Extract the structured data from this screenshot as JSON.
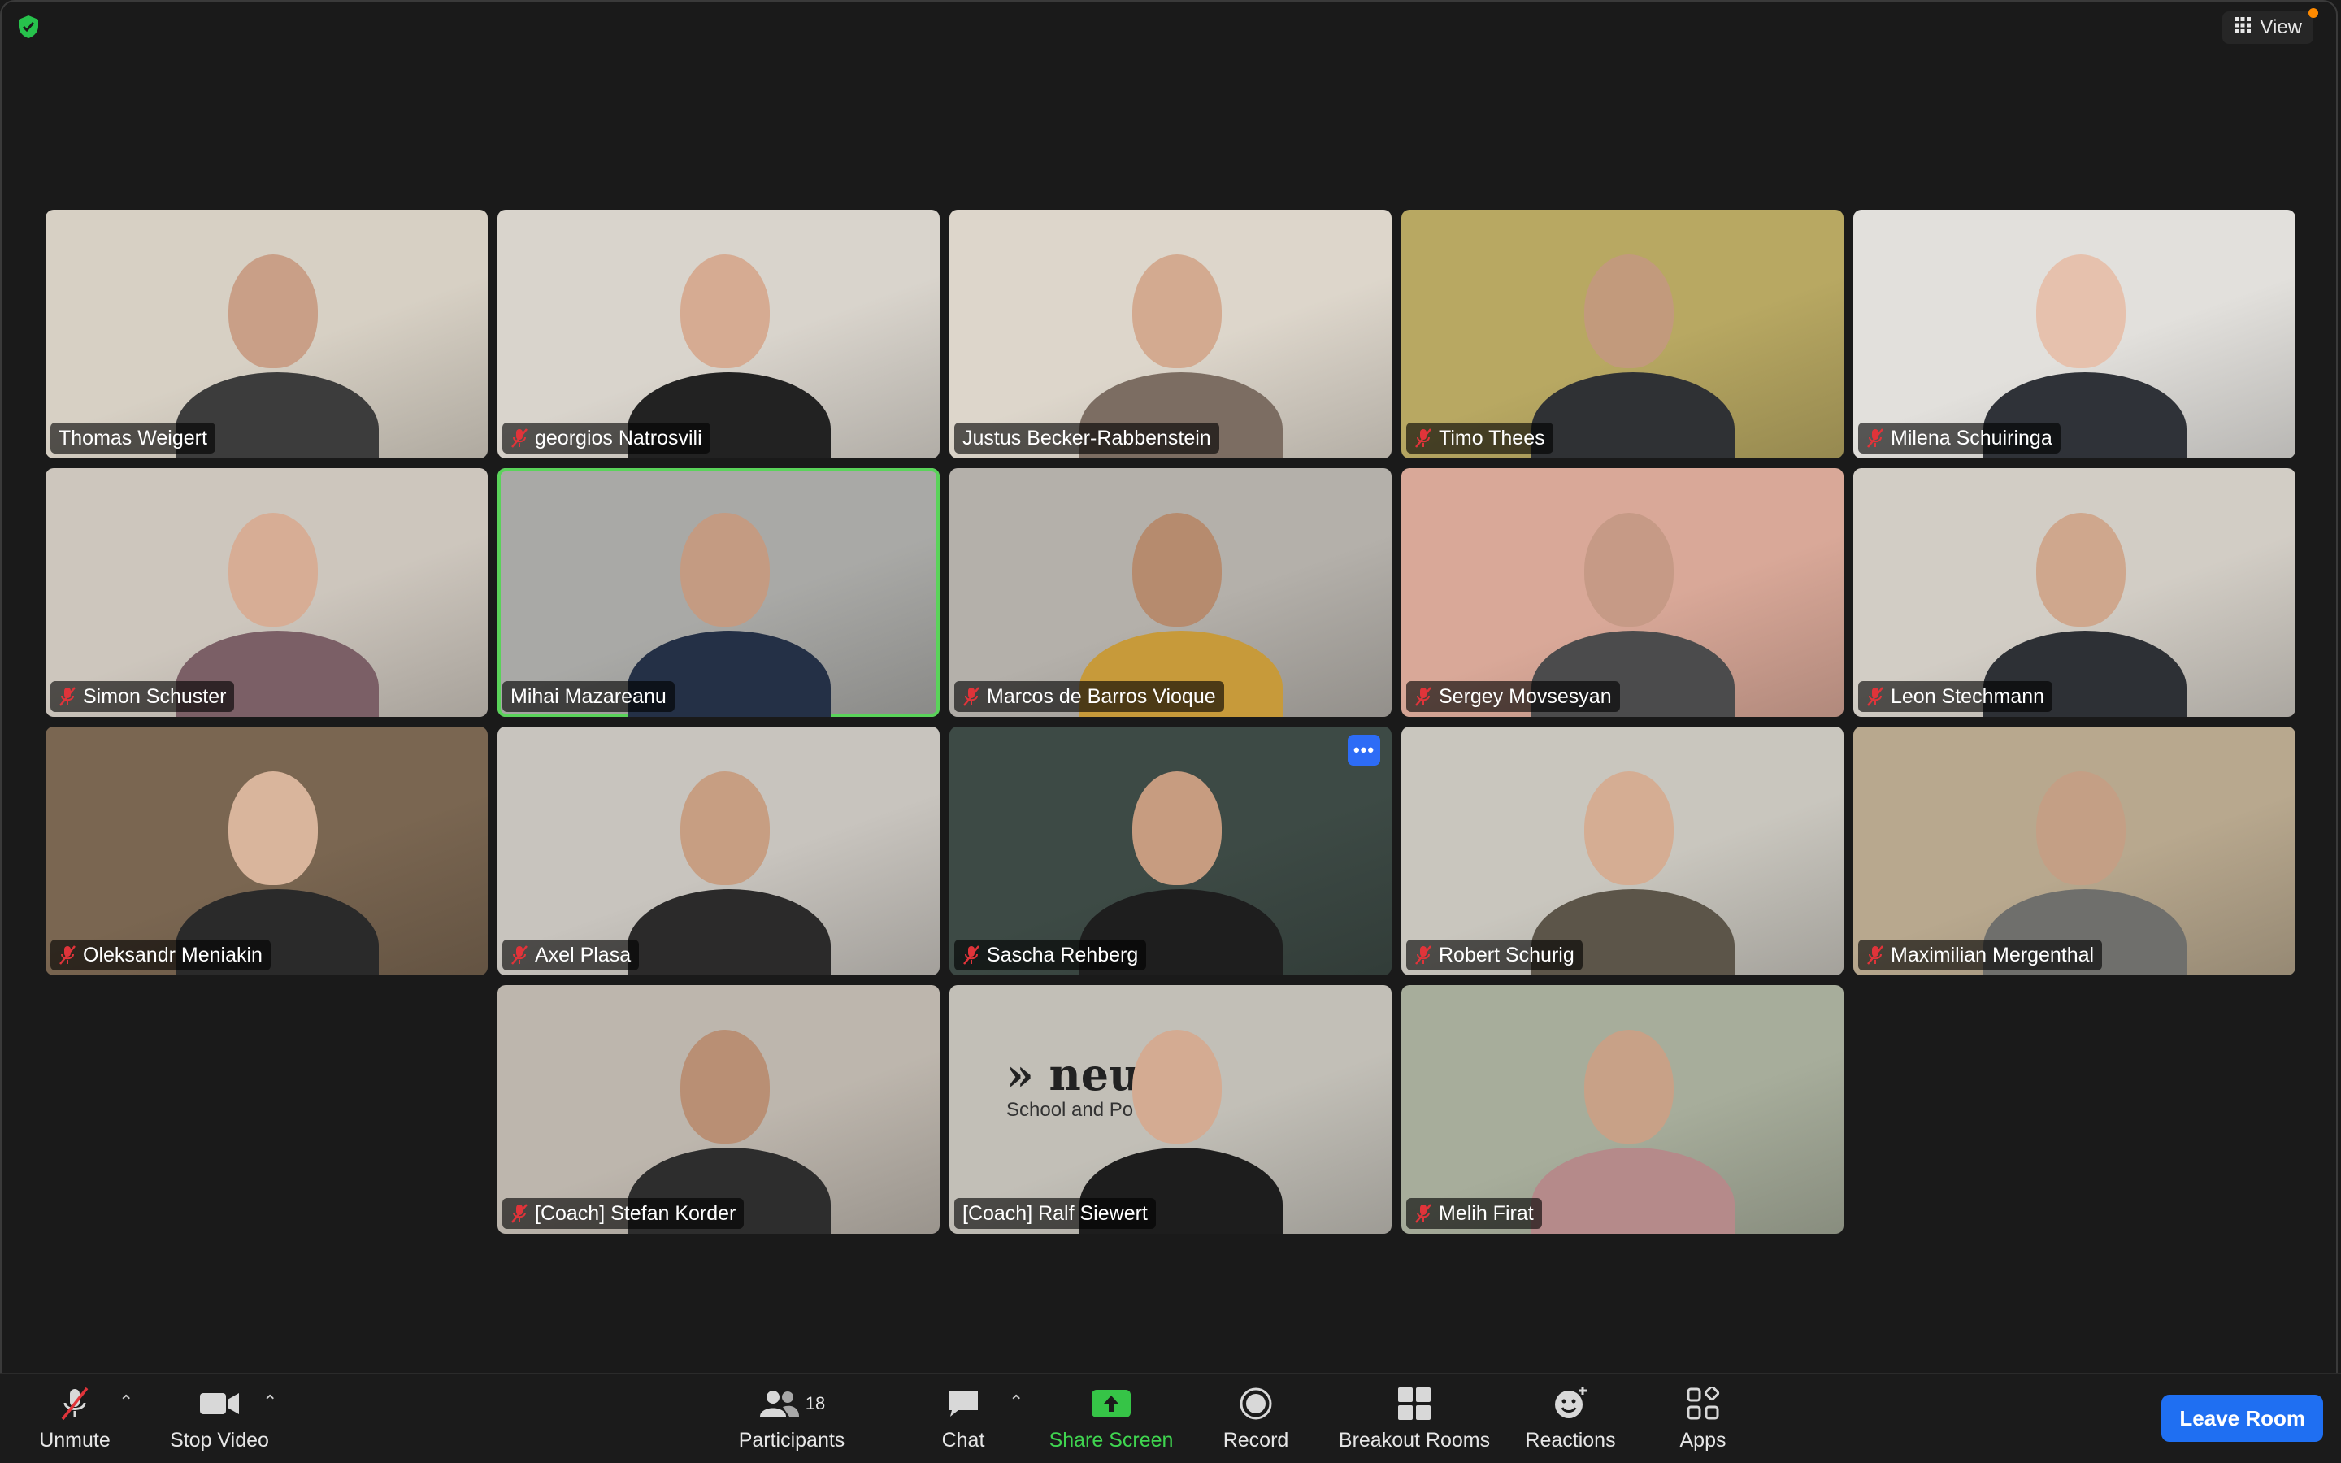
{
  "top_bar": {
    "view_label": "View",
    "security_icon": "shield-check-icon"
  },
  "participants": [
    {
      "name": "Thomas Weigert",
      "muted": false,
      "bg": "#d7d0c4",
      "skin": "#c99f87",
      "shirt": "#3c3c3c"
    },
    {
      "name": "georgios Natrosvili",
      "muted": true,
      "bg": "#d9d4cc",
      "skin": "#d6ab92",
      "shirt": "#222222"
    },
    {
      "name": "Justus Becker-Rabbenstein",
      "muted": false,
      "bg": "#ddd6cb",
      "skin": "#d3aa90",
      "shirt": "#7c6d62"
    },
    {
      "name": "Timo Thees",
      "muted": true,
      "bg": "#b8a862",
      "skin": "#c29a7c",
      "shirt": "#2f3134"
    },
    {
      "name": "Milena Schuiringa",
      "muted": true,
      "bg": "#e2e0dc",
      "skin": "#e6c1ad",
      "shirt": "#2f3238"
    },
    {
      "name": "Simon Schuster",
      "muted": true,
      "bg": "#cdc6bd",
      "skin": "#d7ad95",
      "shirt": "#7b5f66"
    },
    {
      "name": "Mihai Mazareanu",
      "muted": false,
      "bg": "#a9a9a6",
      "skin": "#c49b82",
      "shirt": "#243046",
      "active": true
    },
    {
      "name": "Marcos de Barros Vioque",
      "muted": true,
      "bg": "#b4b0aa",
      "skin": "#b68b6e",
      "shirt": "#c79a3a"
    },
    {
      "name": "Sergey Movsesyan",
      "muted": true,
      "bg": "#d9a898",
      "skin": "#c69a86",
      "shirt": "#4b4b4c"
    },
    {
      "name": "Leon Stechmann",
      "muted": true,
      "bg": "#d2cdc5",
      "skin": "#cfa78d",
      "shirt": "#2d3035"
    },
    {
      "name": "Oleksandr Meniakin",
      "muted": true,
      "bg": "#7a6651",
      "skin": "#d9b59c",
      "shirt": "#2a2a2a"
    },
    {
      "name": "Axel Plasa",
      "muted": true,
      "bg": "#c8c4be",
      "skin": "#c79e82",
      "shirt": "#2b2a2a"
    },
    {
      "name": "Sascha Rehberg",
      "muted": true,
      "bg": "#3d4a45",
      "skin": "#c79c80",
      "shirt": "#1e1e1e",
      "more": true
    },
    {
      "name": "Robert Schurig",
      "muted": true,
      "bg": "#c9c6be",
      "skin": "#d5ad93",
      "shirt": "#5c5549"
    },
    {
      "name": "Maximilian Mergenthal",
      "muted": true,
      "bg": "#b8a88e",
      "skin": "#c49f85",
      "shirt": "#6f6f6c"
    },
    {
      "name": "[Coach] Stefan Korder",
      "muted": true,
      "bg": "#bdb6ad",
      "skin": "#b98f74",
      "shirt": "#2d2d2d"
    },
    {
      "name": "[Coach] Ralf Siewert",
      "muted": false,
      "bg": "#c2bfb7",
      "skin": "#d4ab92",
      "shirt": "#1d1d1d",
      "logo": true
    },
    {
      "name": "Melih Firat",
      "muted": true,
      "bg": "#a7ad9b",
      "skin": "#c8a187",
      "shirt": "#b58a8a"
    }
  ],
  "logo": {
    "title": "» neu     he",
    "subtitle": "School and Po          ent"
  },
  "toolbar": {
    "unmute": "Unmute",
    "stop_video": "Stop Video",
    "participants": "Participants",
    "participants_count": "18",
    "chat": "Chat",
    "share_screen": "Share Screen",
    "record": "Record",
    "breakout_rooms": "Breakout Rooms",
    "reactions": "Reactions",
    "apps": "Apps",
    "leave": "Leave Room"
  }
}
